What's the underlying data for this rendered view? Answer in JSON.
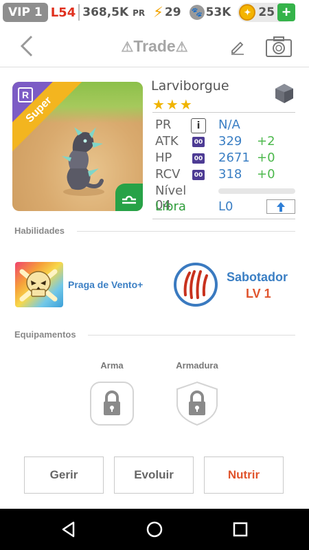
{
  "status_bar": {
    "vip": "VIP 1",
    "level": "L54",
    "power": "368,5K",
    "power_unit": "PR",
    "energy": "29",
    "paws": "53K",
    "coins": "25"
  },
  "header": {
    "title": "Trade"
  },
  "monster": {
    "name": "Larviborgue",
    "rarity": "R",
    "tier": "Super",
    "stars": "★★★",
    "stats": [
      {
        "label": "PR",
        "value": "N/A",
        "bonus": ""
      },
      {
        "label": "ATK",
        "tag": "00",
        "value": "329",
        "bonus": "+2"
      },
      {
        "label": "HP",
        "tag": "00",
        "value": "2671",
        "bonus": "+0"
      },
      {
        "label": "RCV",
        "tag": "00",
        "value": "318",
        "bonus": "+0"
      }
    ],
    "level_label": "Nível 04",
    "level_progress": 0,
    "sign": "Libra",
    "sign_level": "L0"
  },
  "skills": {
    "section_label": "Habilidades",
    "skill_name": "Praga de Vento+",
    "ability_name": "Sabotador",
    "ability_level": "LV 1"
  },
  "equipment": {
    "section_label": "Equipamentos",
    "weapon_label": "Arma",
    "armor_label": "Armadura"
  },
  "actions": {
    "manage": "Gerir",
    "evolve": "Evoluir",
    "feed": "Nutrir"
  },
  "colors": {
    "accent_blue": "#3b7fc4",
    "bonus_green": "#4cb84c",
    "warn_orange": "#e0542d"
  }
}
